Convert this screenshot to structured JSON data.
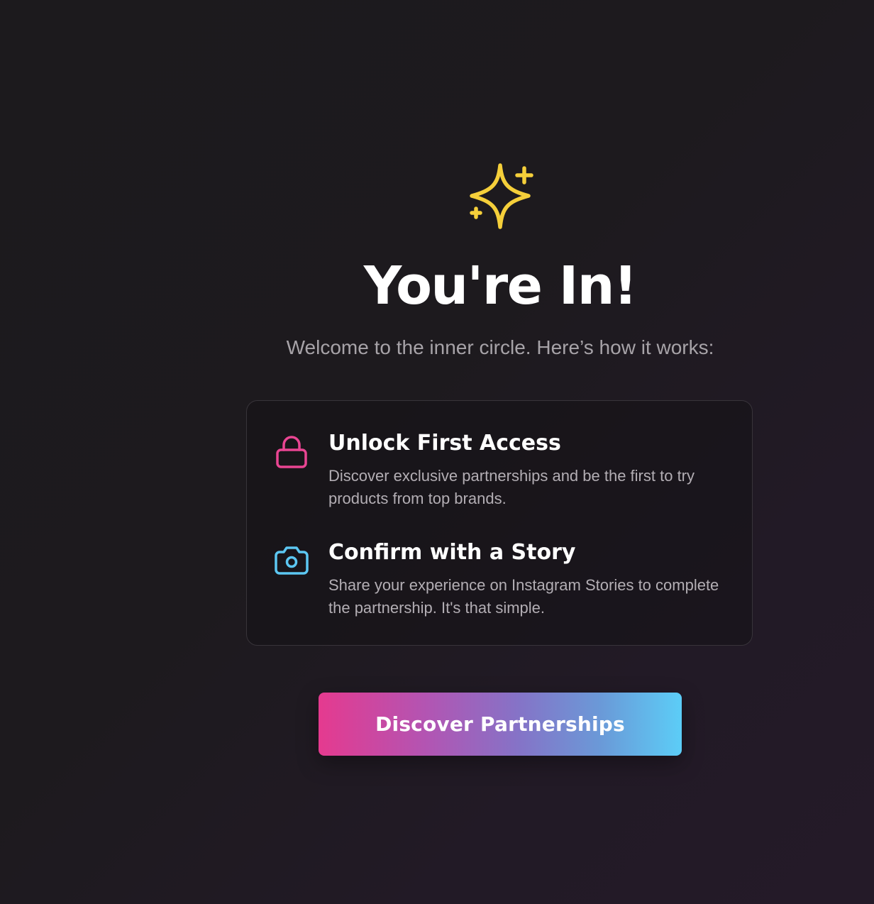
{
  "hero": {
    "icon": "sparkles-icon",
    "title": "You're In!",
    "subtitle": "Welcome to the inner circle. Here’s how it works:"
  },
  "steps": [
    {
      "icon": "lock-icon",
      "title": "Unlock First Access",
      "description": "Discover exclusive partnerships and be the first to try products from top brands."
    },
    {
      "icon": "camera-icon",
      "title": "Confirm with a Story",
      "description": "Share your experience on Instagram Stories to complete the partnership. It's that simple."
    }
  ],
  "cta": {
    "label": "Discover Partnerships"
  },
  "colors": {
    "background": "#1d1a1e",
    "sparkle": "#f5cf3a",
    "lock": "#e94592",
    "camera": "#5cc7f2",
    "button_start": "#e53a8f",
    "button_end": "#5ccdf7"
  }
}
